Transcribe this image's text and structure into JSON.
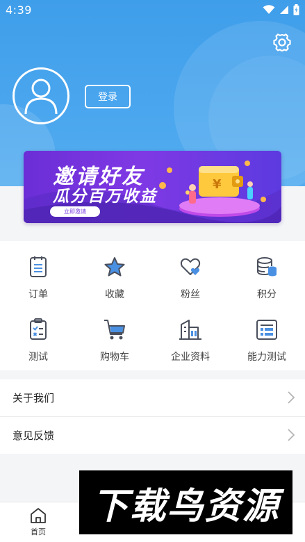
{
  "status_bar": {
    "time": "4:39"
  },
  "profile": {
    "login_label": "登录"
  },
  "banner": {
    "title": "邀请好友",
    "subtitle": "瓜分百万收益",
    "cta": "立即邀请",
    "currency_symbol": "¥"
  },
  "grid": [
    {
      "label": "订单",
      "icon": "clipboard-list-icon"
    },
    {
      "label": "收藏",
      "icon": "star-icon"
    },
    {
      "label": "粉丝",
      "icon": "heart-icon"
    },
    {
      "label": "积分",
      "icon": "coin-stack-icon"
    },
    {
      "label": "测试",
      "icon": "checklist-icon"
    },
    {
      "label": "购物车",
      "icon": "shopping-cart-icon"
    },
    {
      "label": "企业资料",
      "icon": "buildings-icon"
    },
    {
      "label": "能力测试",
      "icon": "report-icon"
    }
  ],
  "menu": [
    {
      "label": "关于我们"
    },
    {
      "label": "意见反馈"
    }
  ],
  "tabbar": [
    {
      "label": "首页",
      "icon": "home-icon"
    }
  ],
  "watermark": {
    "text": "下载鸟资源"
  },
  "colors": {
    "header_blue": "#3f9eea",
    "icon_accent": "#4a90e2",
    "banner_purple": "#7f39e4"
  }
}
